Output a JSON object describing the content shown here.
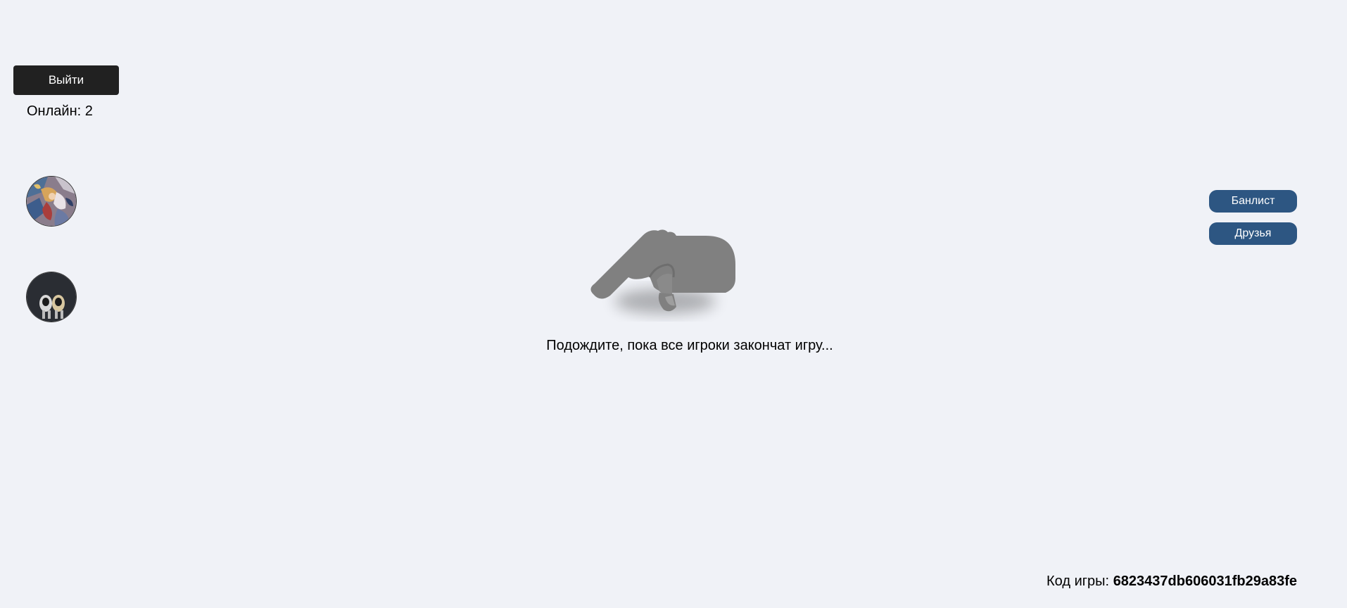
{
  "header": {
    "exit_label": "Выйти",
    "online_label": "Онлайн: 2"
  },
  "players": [
    {
      "avatar": "player-avatar-colorful"
    },
    {
      "avatar": "player-avatar-dark"
    }
  ],
  "side_actions": {
    "banlist_label": "Банлист",
    "friends_label": "Друзья"
  },
  "main": {
    "waiting_icon": "hand-pointing-icon",
    "waiting_text": "Подождите, пока все игроки закончат игру..."
  },
  "footer": {
    "code_label": "Код игры:",
    "code_value": "6823437db606031fb29a83fe"
  },
  "colors": {
    "background": "#f0f2f7",
    "exit_button": "#212121",
    "pill_button": "#2d5682",
    "hand": "#808080"
  }
}
